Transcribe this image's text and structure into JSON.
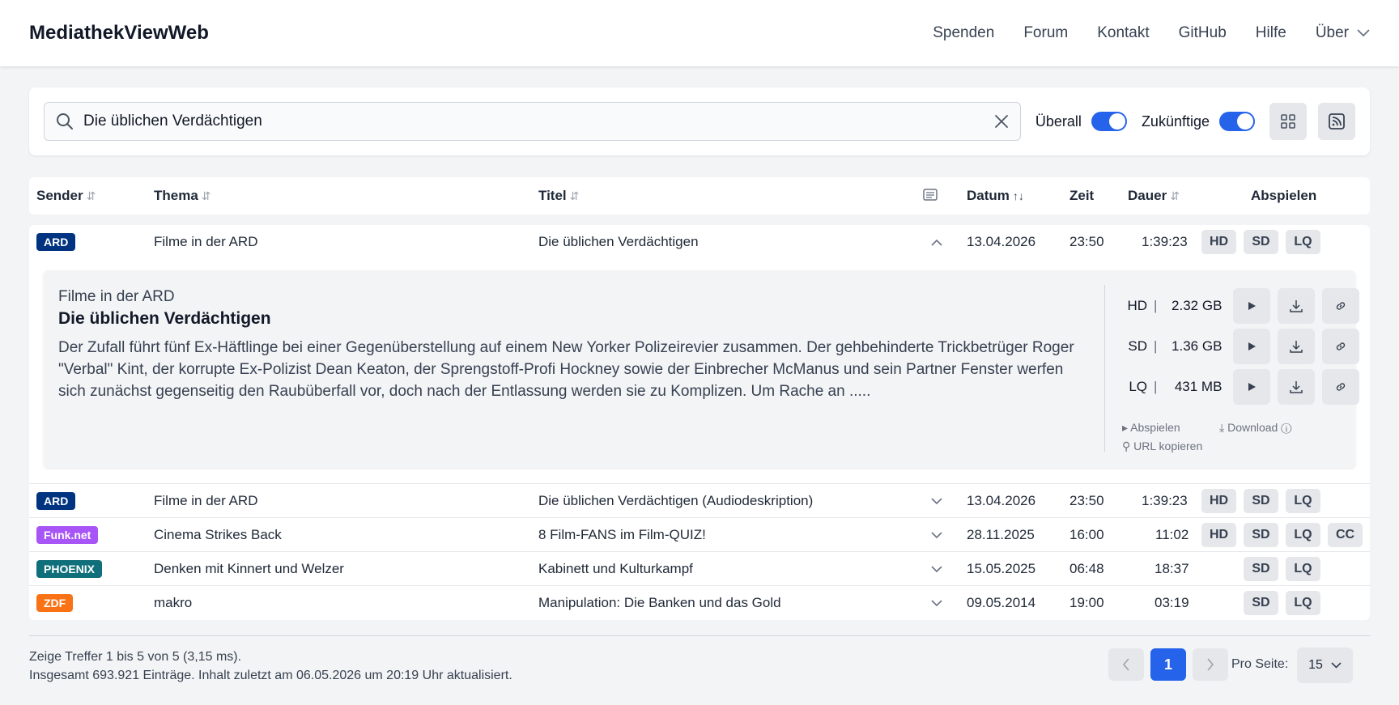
{
  "app": {
    "title": "MediathekViewWeb"
  },
  "nav": [
    "Spenden",
    "Forum",
    "Kontakt",
    "GitHub",
    "Hilfe",
    "Über"
  ],
  "search": {
    "value": "Die üblichen Verdächtigen",
    "placeholder": ""
  },
  "toggles": {
    "everywhere": "Überall",
    "future": "Zukünftige"
  },
  "columns": {
    "sender": "Sender",
    "topic": "Thema",
    "title": "Titel",
    "date": "Datum",
    "time": "Zeit",
    "duration": "Dauer",
    "play": "Abspielen"
  },
  "rows": [
    {
      "sender": "ARD",
      "sender_color": "#003480",
      "topic": "Filme in der ARD",
      "title": "Die üblichen Verdächtigen",
      "date": "13.04.2026",
      "time": "23:50",
      "duration": "1:39:23",
      "qualities": [
        "HD",
        "SD",
        "LQ"
      ],
      "expanded": true
    },
    {
      "sender": "ARD",
      "sender_color": "#003480",
      "topic": "Filme in der ARD",
      "title": "Die üblichen Verdächtigen (Audiodeskription)",
      "date": "13.04.2026",
      "time": "23:50",
      "duration": "1:39:23",
      "qualities": [
        "HD",
        "SD",
        "LQ"
      ]
    },
    {
      "sender": "Funk.net",
      "sender_color": "#a855f7",
      "topic": "Cinema Strikes Back",
      "title": "8 Film-FANS im Film-QUIZ!",
      "date": "28.11.2025",
      "time": "16:00",
      "duration": "11:02",
      "qualities": [
        "HD",
        "SD",
        "LQ",
        "CC"
      ]
    },
    {
      "sender": "PHOENIX",
      "sender_color": "#0f6f7a",
      "topic": "Denken mit Kinnert und Welzer",
      "title": "Kabinett und Kulturkampf",
      "date": "15.05.2025",
      "time": "06:48",
      "duration": "18:37",
      "qualities": [
        "SD",
        "LQ"
      ]
    },
    {
      "sender": "ZDF",
      "sender_color": "#f97316",
      "topic": "makro",
      "title": "Manipulation: Die Banken und das Gold",
      "date": "09.05.2014",
      "time": "19:00",
      "duration": "03:19",
      "qualities": [
        "SD",
        "LQ"
      ]
    }
  ],
  "detail": {
    "topic": "Filme in der ARD",
    "title": "Die üblichen Verdächtigen",
    "description": "Der Zufall führt fünf Ex-Häftlinge bei einer Gegenüberstellung auf einem New Yorker Polizeirevier zusammen. Der gehbehinderte Trickbetrüger Roger \"Verbal\" Kint, der korrupte Ex-Polizist Dean Keaton, der Sprengstoff-Profi Hockney sowie der Einbrecher McManus und sein Partner Fenster werfen sich zunächst gegenseitig den Raubüberfall vor, doch nach der Entlassung werden sie zu Komplizen. Um Rache an .....",
    "files": [
      {
        "quality": "HD",
        "size": "2.32 GB"
      },
      {
        "quality": "SD",
        "size": "1.36 GB"
      },
      {
        "quality": "LQ",
        "size": "431 MB"
      }
    ],
    "legend": {
      "play": "Abspielen",
      "download": "Download",
      "copy": "URL kopieren"
    }
  },
  "footer": {
    "line1": "Zeige Treffer 1 bis 5 von 5 (3,15 ms).",
    "line2": "Insgesamt 693.921 Einträge.  Inhalt zuletzt am 06.05.2026 um 20:19 Uhr aktualisiert."
  },
  "pagination": {
    "current": "1",
    "per_page_label": "Pro Seite:",
    "per_page": "15"
  },
  "colors": {
    "accent": "#2563eb"
  }
}
